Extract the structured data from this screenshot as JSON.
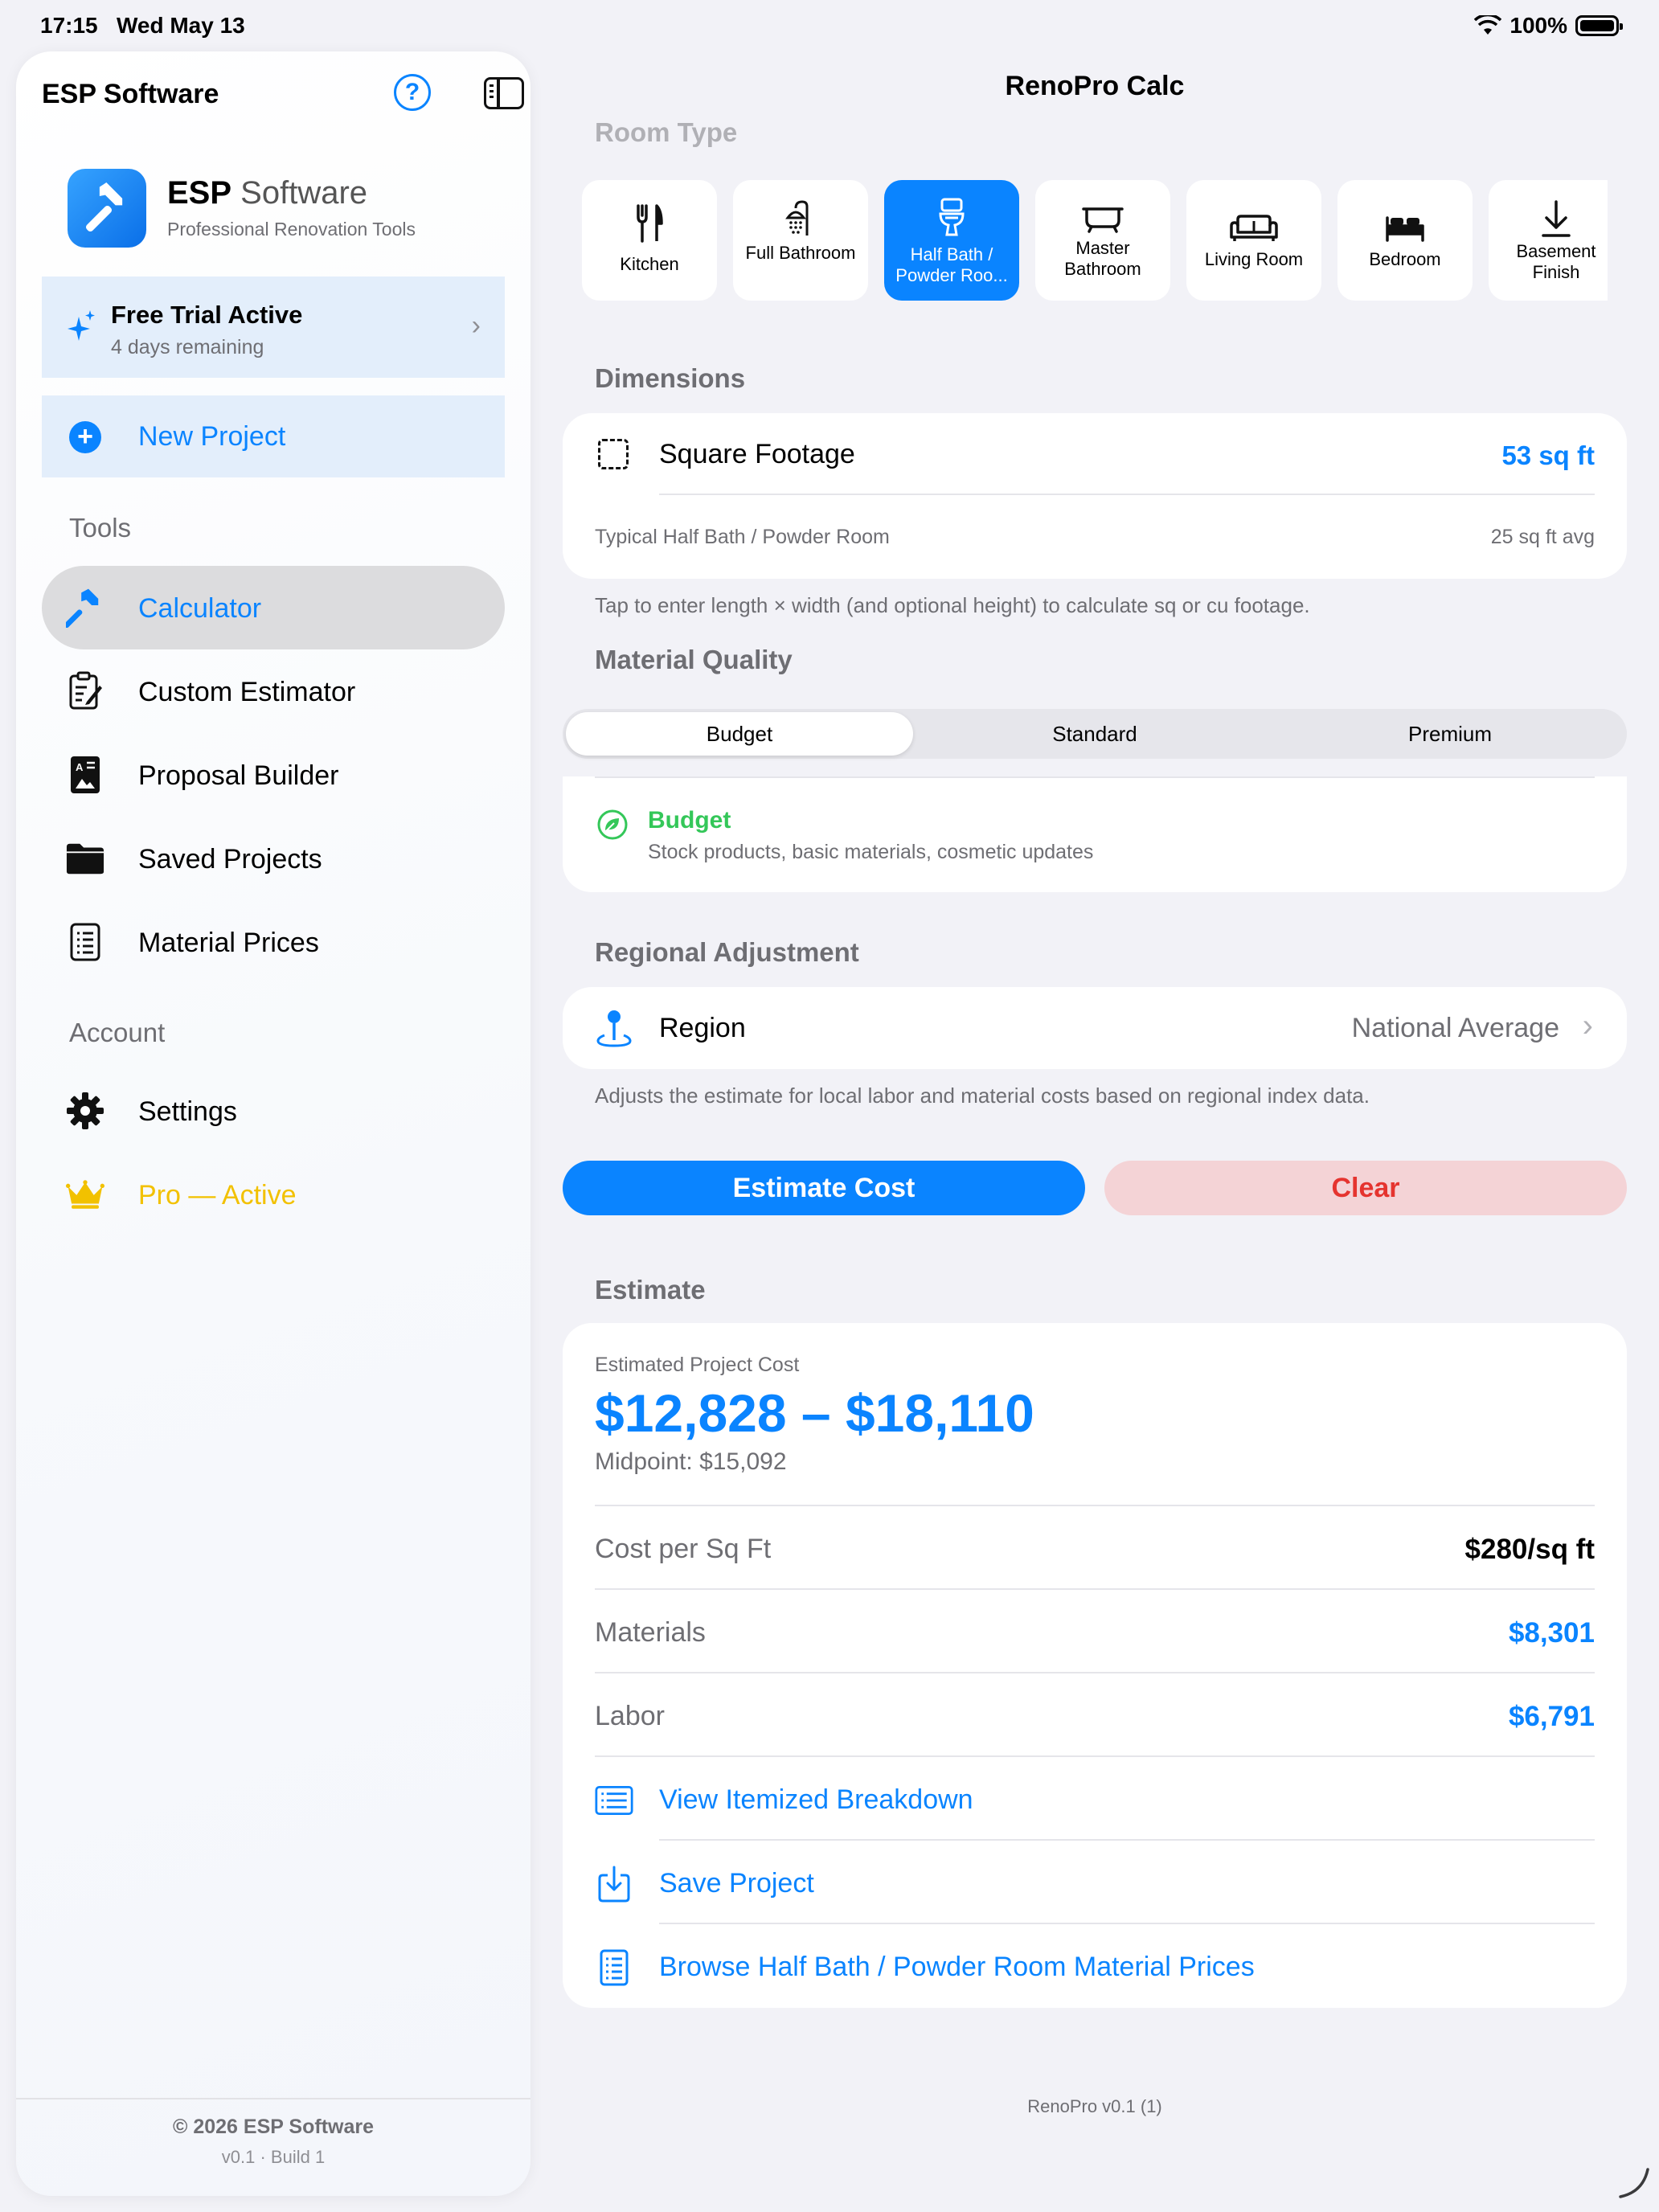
{
  "status": {
    "time": "17:15",
    "date": "Wed May 13",
    "battery": "100%"
  },
  "sidebar": {
    "title": "ESP Software",
    "brand": {
      "name_bold": "ESP",
      "name_rest": "Software",
      "subtitle": "Professional Renovation Tools"
    },
    "trial": {
      "title": "Free Trial Active",
      "subtitle": "4 days remaining"
    },
    "new_project": "New Project",
    "tools_header": "Tools",
    "tools": [
      {
        "label": "Calculator",
        "icon": "hammer-icon",
        "selected": true
      },
      {
        "label": "Custom Estimator",
        "icon": "clipboard-edit-icon"
      },
      {
        "label": "Proposal Builder",
        "icon": "document-image-icon"
      },
      {
        "label": "Saved Projects",
        "icon": "folder-icon"
      },
      {
        "label": "Material Prices",
        "icon": "list-document-icon"
      }
    ],
    "account_header": "Account",
    "account": [
      {
        "label": "Settings",
        "icon": "gear-icon"
      },
      {
        "label": "Pro — Active",
        "icon": "crown-icon"
      }
    ],
    "footer": {
      "copyright": "© 2026 ESP Software",
      "version": "v0.1  ·  Build 1"
    }
  },
  "main": {
    "title": "RenoPro Calc",
    "room_type_label": "Room Type",
    "room_types": [
      {
        "label": "Kitchen",
        "icon": "fork-knife-icon"
      },
      {
        "label": "Full Bathroom",
        "icon": "shower-icon"
      },
      {
        "label": "Half Bath / Powder Roo...",
        "icon": "toilet-icon",
        "selected": true
      },
      {
        "label": "Master Bathroom",
        "icon": "bathtub-icon"
      },
      {
        "label": "Living Room",
        "icon": "sofa-icon"
      },
      {
        "label": "Bedroom",
        "icon": "bed-icon"
      },
      {
        "label": "Basement Finish",
        "icon": "arrow-down-icon"
      }
    ],
    "dimensions": {
      "label": "Dimensions",
      "sqft_label": "Square Footage",
      "sqft_value": "53 sq ft",
      "typical_label": "Typical Half Bath / Powder Room",
      "typical_value": "25 sq ft avg",
      "hint": "Tap to enter length × width (and optional height) to calculate sq or cu footage."
    },
    "quality": {
      "label": "Material Quality",
      "options": [
        "Budget",
        "Standard",
        "Premium"
      ],
      "selected": "Budget",
      "detail_title": "Budget",
      "detail_sub": "Stock products, basic materials, cosmetic updates"
    },
    "regional": {
      "label": "Regional Adjustment",
      "row_label": "Region",
      "row_value": "National Average",
      "hint": "Adjusts the estimate for local labor and material costs based on regional index data."
    },
    "buttons": {
      "estimate": "Estimate Cost",
      "clear": "Clear"
    },
    "estimate": {
      "label": "Estimate",
      "caption": "Estimated Project Cost",
      "range": "$12,828 – $18,110",
      "midpoint": "Midpoint: $15,092",
      "rows": [
        {
          "label": "Cost per Sq Ft",
          "value": "$280/sq ft"
        },
        {
          "label": "Materials",
          "value": "$8,301"
        },
        {
          "label": "Labor",
          "value": "$6,791"
        }
      ],
      "actions": [
        {
          "label": "View Itemized Breakdown",
          "icon": "list-icon"
        },
        {
          "label": "Save Project",
          "icon": "save-download-icon"
        },
        {
          "label": "Browse Half Bath / Powder Room Material Prices",
          "icon": "document-list-icon"
        }
      ]
    },
    "footer_version": "RenoPro v0.1 (1)"
  },
  "colors": {
    "accent": "#0a84ff",
    "budget_green": "#34c759",
    "clear_red": "#e5342f",
    "pro_gold": "#f2c100"
  }
}
